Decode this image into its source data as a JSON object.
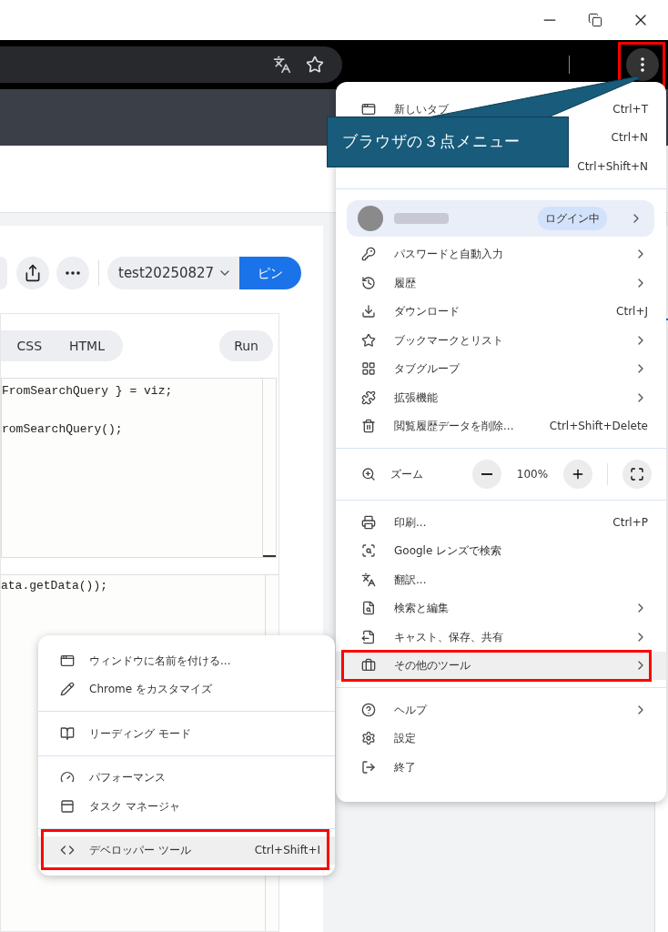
{
  "toolbar": {
    "menu_button": {
      "highlighted": true
    }
  },
  "page": {
    "dropdown": "test20250827",
    "pin_button": "ピン",
    "editor_tabs": [
      {
        "label": "CSS"
      },
      {
        "label": "HTML"
      }
    ],
    "run_button": "Run",
    "code_upper": [
      "FromSearchQuery } = viz;",
      "romSearchQuery();"
    ],
    "code_lower": [
      "ata.getData());"
    ]
  },
  "menu": {
    "sections": [
      [
        {
          "kind": "item",
          "label": "新しいタブ",
          "shortcut": "Ctrl+T",
          "submenu": false,
          "highlighted": false
        },
        {
          "kind": "item",
          "shortcut": "Ctrl+N",
          "submenu": false,
          "highlighted": false
        },
        {
          "kind": "item",
          "shortcut": "Ctrl+Shift+N",
          "submenu": false,
          "highlighted": false
        }
      ],
      [
        {
          "kind": "profile",
          "badge": "ログイン中",
          "submenu": true
        },
        {
          "kind": "item",
          "label": "パスワードと自動入力",
          "submenu": true,
          "highlighted": false
        },
        {
          "kind": "item",
          "label": "履歴",
          "submenu": true,
          "highlighted": false
        },
        {
          "kind": "item",
          "label": "ダウンロード",
          "shortcut": "Ctrl+J",
          "submenu": false,
          "highlighted": false
        },
        {
          "kind": "item",
          "label": "ブックマークとリスト",
          "submenu": true,
          "highlighted": false
        },
        {
          "kind": "item",
          "label": "タブグループ",
          "submenu": true,
          "highlighted": false
        },
        {
          "kind": "item",
          "label": "拡張機能",
          "submenu": true,
          "highlighted": false
        },
        {
          "kind": "item",
          "label": "閲覧履歴データを削除...",
          "shortcut": "Ctrl+Shift+Delete",
          "submenu": false,
          "highlighted": false
        }
      ],
      [
        {
          "kind": "zoom",
          "label": "ズーム",
          "value": "100%"
        }
      ],
      [
        {
          "kind": "item",
          "label": "印刷...",
          "shortcut": "Ctrl+P",
          "submenu": false,
          "highlighted": false
        },
        {
          "kind": "item",
          "label": "Google レンズで検索",
          "submenu": false,
          "highlighted": false
        },
        {
          "kind": "item",
          "label": "翻訳...",
          "submenu": false,
          "highlighted": false
        },
        {
          "kind": "item",
          "label": "検索と編集",
          "submenu": true,
          "highlighted": false
        },
        {
          "kind": "item",
          "label": "キャスト、保存、共有",
          "submenu": true,
          "highlighted": false
        },
        {
          "kind": "item",
          "label": "その他のツール",
          "submenu": true,
          "highlighted": true
        }
      ],
      [
        {
          "kind": "item",
          "label": "ヘルプ",
          "submenu": true,
          "highlighted": false
        },
        {
          "kind": "item",
          "label": "設定",
          "submenu": false,
          "highlighted": false
        },
        {
          "kind": "item",
          "label": "終了",
          "submenu": false,
          "highlighted": false
        }
      ]
    ]
  },
  "submenu": {
    "sections": [
      [
        {
          "label": "ウィンドウに名前を付ける...",
          "highlighted": false
        },
        {
          "label": "Chrome をカスタマイズ",
          "highlighted": false
        }
      ],
      [
        {
          "label": "リーディング モード",
          "highlighted": false
        }
      ],
      [
        {
          "label": "パフォーマンス",
          "highlighted": false
        },
        {
          "label": "タスク マネージャ",
          "highlighted": false
        }
      ],
      [
        {
          "label": "デベロッパー ツール",
          "shortcut": "Ctrl+Shift+I",
          "highlighted": true
        }
      ]
    ]
  },
  "annotation": {
    "text": "ブラウザの３点メニュー"
  }
}
